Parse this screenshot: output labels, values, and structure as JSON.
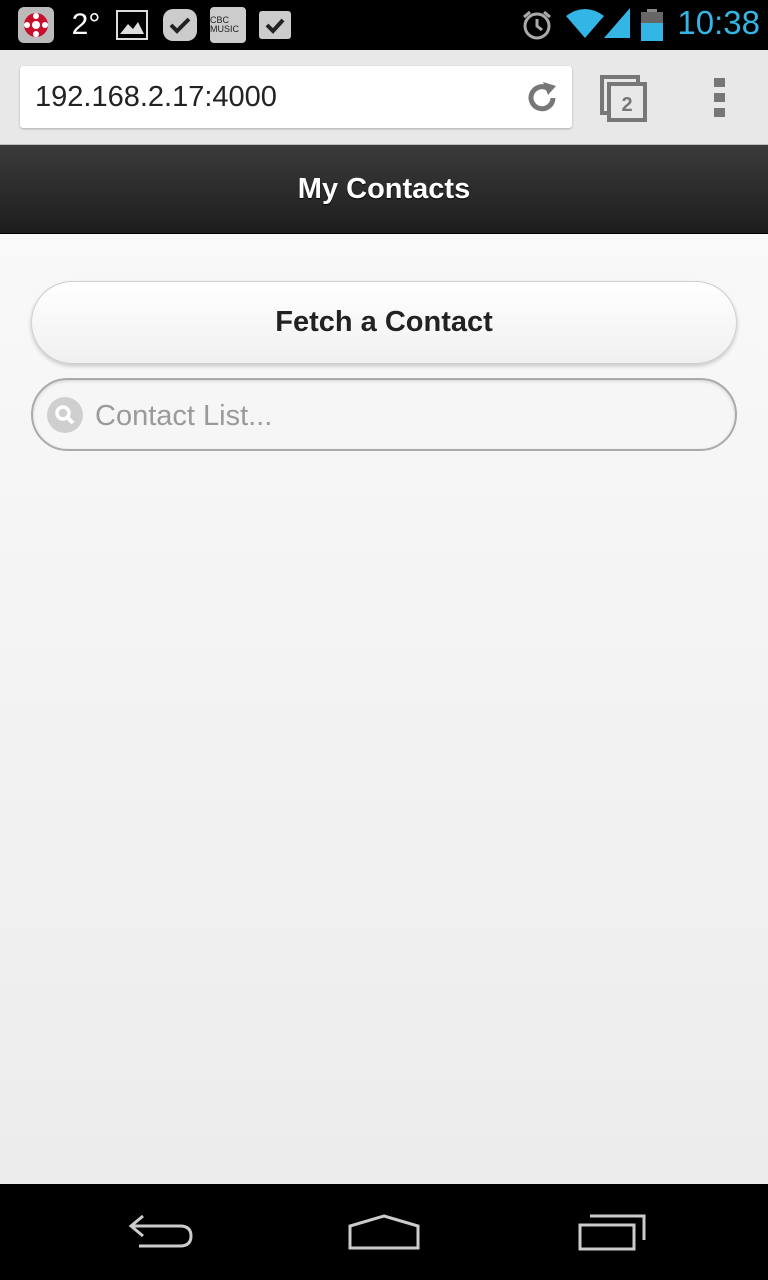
{
  "status_bar": {
    "temperature": "2°",
    "music_label": "CBC MUSIC",
    "clock": "10:38",
    "icons": [
      "cbc-icon",
      "gallery-icon",
      "check-icon",
      "cbc-music-icon",
      "shopping-bag-icon",
      "alarm-icon",
      "wifi-icon",
      "signal-icon",
      "battery-icon"
    ]
  },
  "browser": {
    "url": "192.168.2.17:4000",
    "tab_count": "2"
  },
  "header": {
    "title": "My Contacts"
  },
  "main": {
    "fetch_button_label": "Fetch a Contact",
    "search_placeholder": "Contact List..."
  },
  "colors": {
    "clock": "#33b5e5",
    "header_bg": "#2b2b2b"
  }
}
